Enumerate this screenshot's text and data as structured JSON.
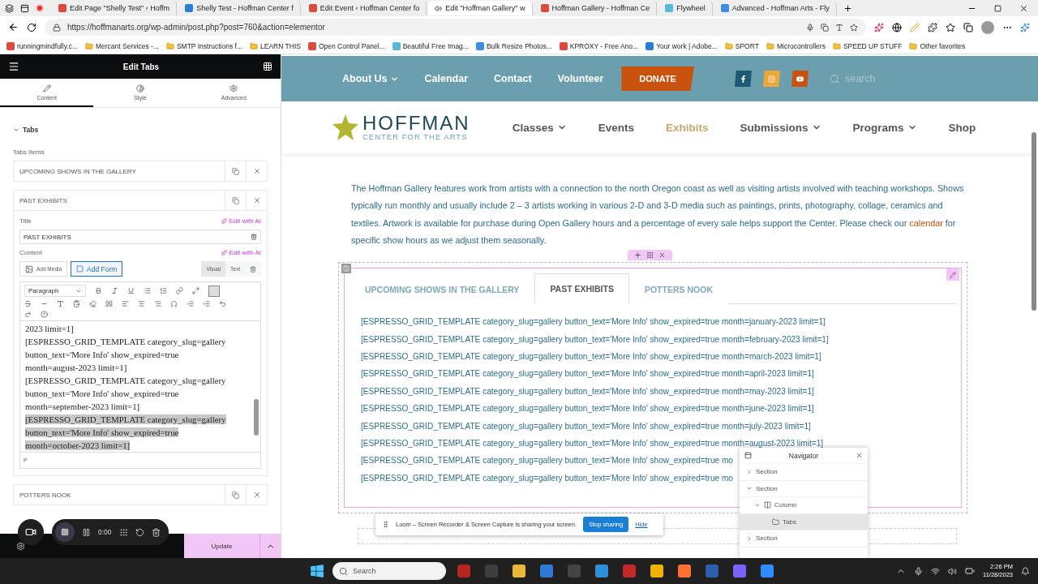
{
  "browser": {
    "tabs": [
      {
        "title": "Edit Page \"Shelly Test\" ‹ Hoffm",
        "selected": false
      },
      {
        "title": "Shelly Test - Hoffman Center f",
        "selected": false
      },
      {
        "title": "Edit Event ‹ Hoffman Center fo",
        "selected": false
      },
      {
        "title": "Edit \"Hoffman Gallery\" w",
        "selected": true
      },
      {
        "title": "Hoffman Gallery - Hoffman Ce",
        "selected": false
      },
      {
        "title": "Flywheel",
        "selected": false
      },
      {
        "title": "Advanced - Hoffman Arts - Fly",
        "selected": false
      }
    ],
    "address": "https://hoffmanarts.org/wp-admin/post.php?post=760&action=elementor",
    "bookmarks": [
      {
        "label": "runningmindfully.c...",
        "kind": "site"
      },
      {
        "label": "Mercant Services -...",
        "kind": "folder"
      },
      {
        "label": "SMTP Instructions f...",
        "kind": "folder"
      },
      {
        "label": "LEARN THIS",
        "kind": "folder"
      },
      {
        "label": "Open Control Panel...",
        "kind": "site"
      },
      {
        "label": "Beautiful Free Imag...",
        "kind": "site"
      },
      {
        "label": "Bulk Resize Photos...",
        "kind": "site"
      },
      {
        "label": "KPROXY - Free Ano...",
        "kind": "site"
      },
      {
        "label": "Your work | Adobe...",
        "kind": "site"
      },
      {
        "label": "SPORT",
        "kind": "folder"
      },
      {
        "label": "Microcontrollers",
        "kind": "folder"
      },
      {
        "label": "SPEED UP STUFF",
        "kind": "folder"
      },
      {
        "label": "Other favorites",
        "kind": "folder"
      }
    ]
  },
  "editor": {
    "title": "Edit Tabs",
    "tabs": [
      {
        "label": "Content",
        "selected": true
      },
      {
        "label": "Style",
        "selected": false
      },
      {
        "label": "Advanced",
        "selected": false
      }
    ],
    "section": "Tabs",
    "items_label": "Tabs Items",
    "items": [
      {
        "title": "UPCOMING SHOWS IN THE GALLERY",
        "expanded": false
      },
      {
        "title": "PAST EXHIBITS",
        "expanded": true
      },
      {
        "title": "POTTERS NOOK",
        "expanded": false
      }
    ],
    "title_label": "Title",
    "title_ai": "Edit with AI",
    "title_value": "PAST EXHIBITS",
    "content_label": "Content",
    "content_ai": "Edit with AI",
    "add_media": "Add Media",
    "add_form": "Add Form",
    "modes": [
      {
        "label": "Visual",
        "selected": true
      },
      {
        "label": "Text",
        "selected": false
      }
    ],
    "format": "Paragraph",
    "paragraphs": [
      {
        "text": "2023 limit=1]",
        "selected": false
      },
      {
        "text": "[ESPRESSO_GRID_TEMPLATE category_slug=gallery button_text='More Info' show_expired=true month=august-2023 limit=1]",
        "selected": false
      },
      {
        "text": "[ESPRESSO_GRID_TEMPLATE category_slug=gallery button_text='More Info' show_expired=true month=september-2023 limit=1]",
        "selected": false
      },
      {
        "text": "[ESPRESSO_GRID_TEMPLATE category_slug=gallery button_text='More Info' show_expired=true month=october-2023 limit=1]",
        "selected": true
      }
    ],
    "path": "P",
    "update": "Update"
  },
  "recorder": {
    "time": "0:00"
  },
  "site": {
    "top_nav": [
      {
        "label": "About Us",
        "dropdown": true
      },
      {
        "label": "Calendar",
        "dropdown": false
      },
      {
        "label": "Contact",
        "dropdown": false
      },
      {
        "label": "Volunteer",
        "dropdown": false
      }
    ],
    "donate": "DONATE",
    "search_placeholder": "search",
    "logo": {
      "name": "HOFFMAN",
      "tagline": "CENTER FOR THE ARTS"
    },
    "nav": [
      {
        "label": "Classes",
        "dropdown": true,
        "selected": false
      },
      {
        "label": "Events",
        "dropdown": false,
        "selected": false
      },
      {
        "label": "Exhibits",
        "dropdown": false,
        "selected": true
      },
      {
        "label": "Submissions",
        "dropdown": true,
        "selected": false
      },
      {
        "label": "Programs",
        "dropdown": true,
        "selected": false
      },
      {
        "label": "Shop",
        "dropdown": false,
        "selected": false
      }
    ],
    "intro": {
      "before": "The Hoffman Gallery features work from artists with a connection to the north Oregon coast as well as visiting artists involved with teaching workshops.  Shows typically run monthly and usually include 2 – 3 artists working in various 2-D and 3-D media such as paintings, prints, photography, collage, ceramics and textiles. Artwork is available for purchase during Open Gallery hours and a percentage of every sale helps support the Center. Please check our ",
      "link": "calendar",
      "after": " for specific show hours as we adjust them seasonally."
    },
    "tabs": [
      {
        "label": "UPCOMING SHOWS IN THE GALLERY",
        "selected": false
      },
      {
        "label": "PAST EXHIBITS",
        "selected": true
      },
      {
        "label": "POTTERS NOOK",
        "selected": false
      }
    ],
    "lines": [
      "[ESPRESSO_GRID_TEMPLATE category_slug=gallery button_text='More Info' show_expired=true month=january-2023 limit=1]",
      "[ESPRESSO_GRID_TEMPLATE category_slug=gallery button_text='More Info' show_expired=true month=february-2023 limit=1]",
      "[ESPRESSO_GRID_TEMPLATE category_slug=gallery button_text='More Info' show_expired=true month=march-2023 limit=1]",
      "[ESPRESSO_GRID_TEMPLATE category_slug=gallery button_text='More Info' show_expired=true month=april-2023 limit=1]",
      "[ESPRESSO_GRID_TEMPLATE category_slug=gallery button_text='More Info' show_expired=true month=may-2023 limit=1]",
      "[ESPRESSO_GRID_TEMPLATE category_slug=gallery button_text='More Info' show_expired=true month=june-2023 limit=1]",
      "[ESPRESSO_GRID_TEMPLATE category_slug=gallery button_text='More Info' show_expired=true month=july-2023 limit=1]",
      "[ESPRESSO_GRID_TEMPLATE category_slug=gallery button_text='More Info' show_expired=true month=august-2023 limit=1]",
      "[ESPRESSO_GRID_TEMPLATE category_slug=gallery button_text='More Info' show_expired=true mo",
      "[ESPRESSO_GRID_TEMPLATE category_slug=gallery button_text='More Info' show_expired=true mo"
    ]
  },
  "navigator": {
    "title": "Navigator",
    "tree": [
      {
        "label": "Section",
        "expanded": false,
        "selected": false
      },
      {
        "label": "Section",
        "expanded": true,
        "selected": false,
        "children": [
          {
            "label": "Column",
            "kind": "column",
            "expanded": true,
            "selected": false,
            "children": [
              {
                "label": "Tabs",
                "kind": "widget",
                "selected": true
              }
            ]
          }
        ]
      },
      {
        "label": "Section",
        "expanded": false,
        "selected": false
      }
    ]
  },
  "loom_banner": {
    "message": "Loom – Screen Recorder & Screen Capture is sharing your screen.",
    "stop": "Stop sharing",
    "hide": "Hide"
  },
  "taskbar": {
    "search_placeholder": "Search",
    "time": "2:26 PM",
    "date": "11/28/2023"
  }
}
